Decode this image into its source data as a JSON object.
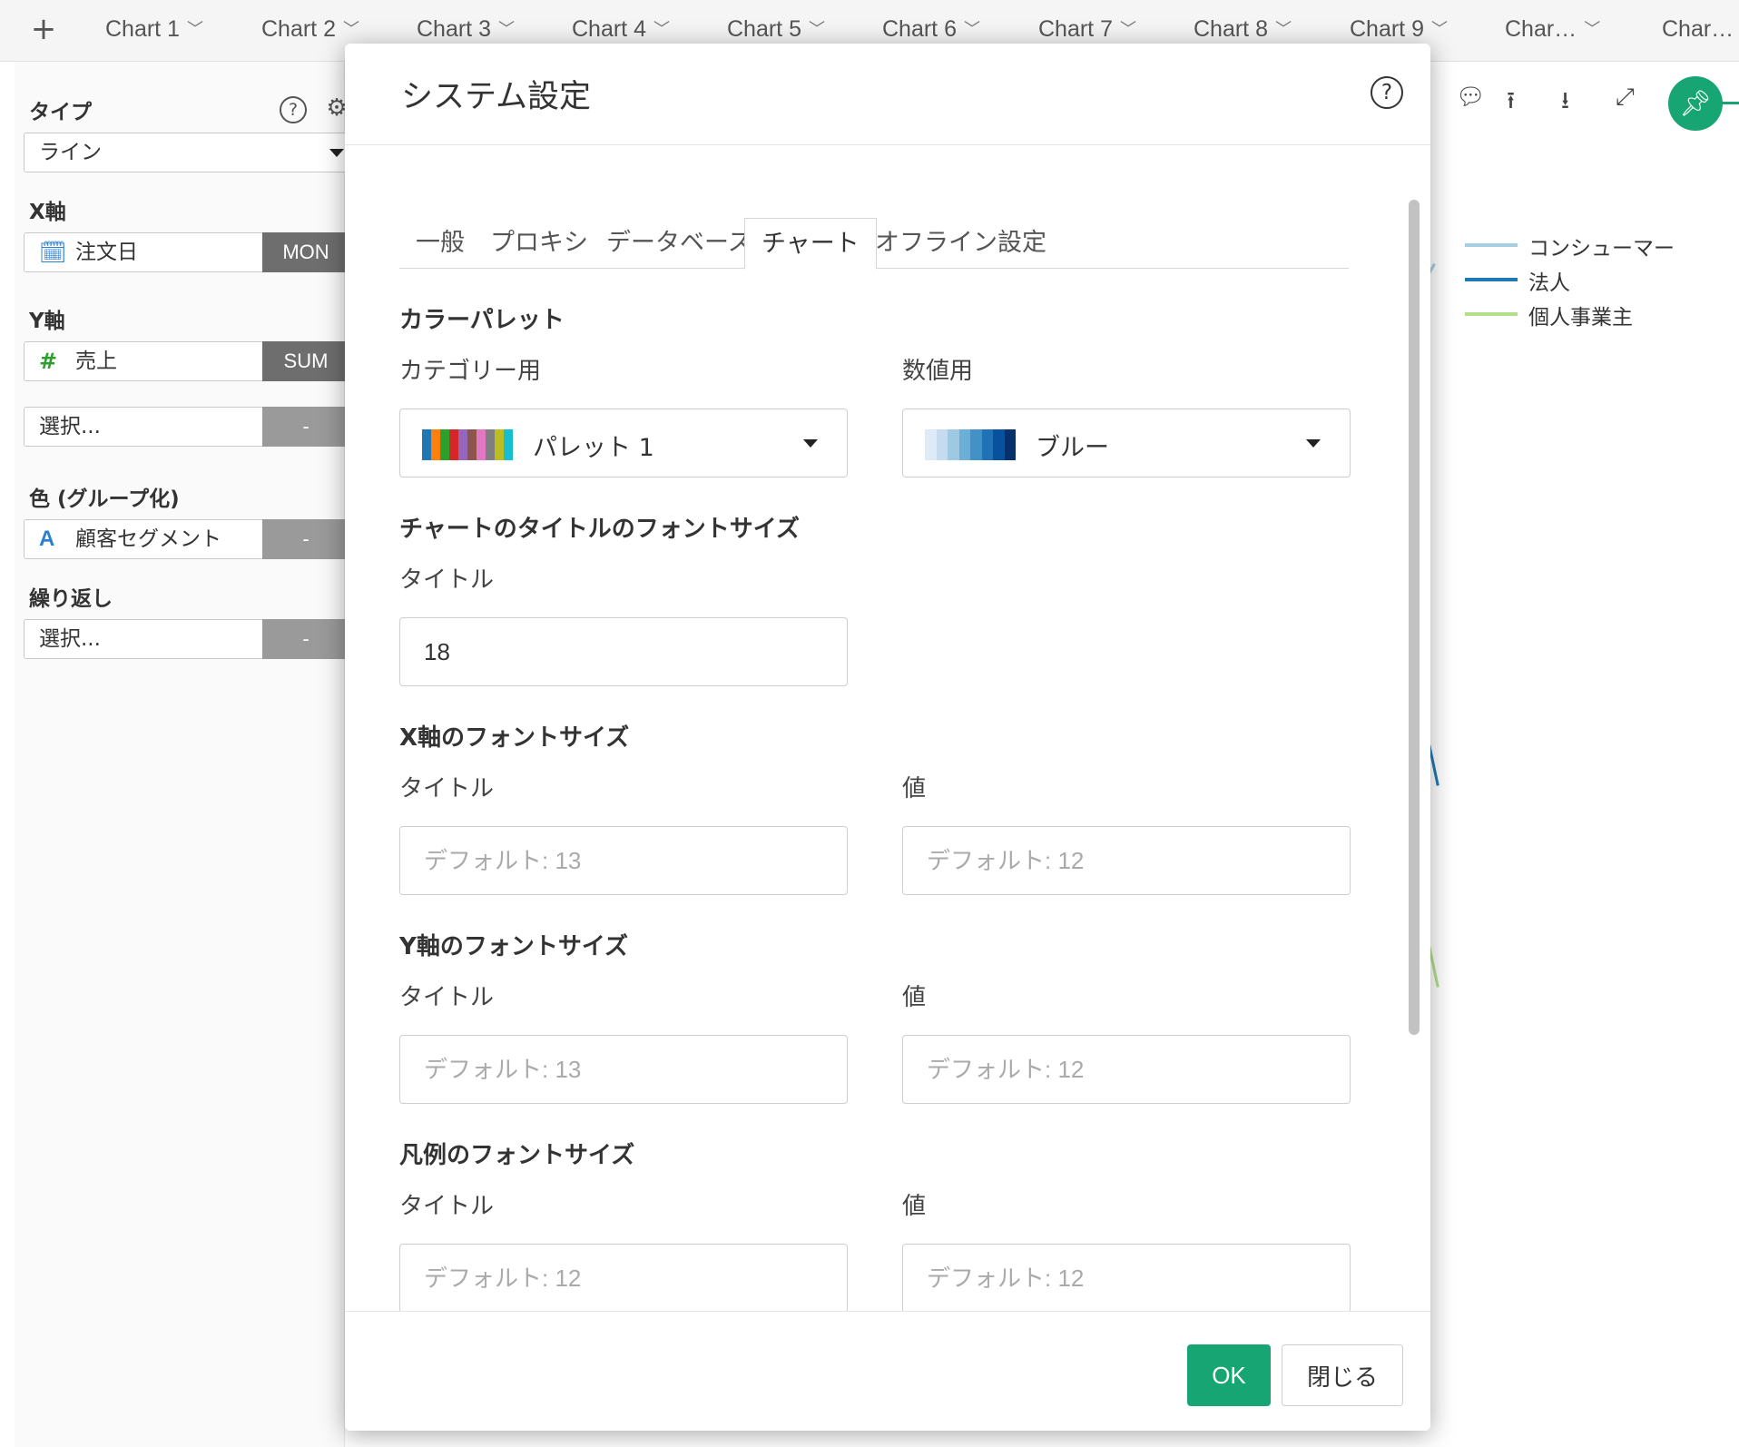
{
  "tabbar": {
    "add_icon": "+",
    "tabs": [
      "Chart 1",
      "Chart 2",
      "Chart 3",
      "Chart 4",
      "Chart 5",
      "Chart 6",
      "Chart 7",
      "Chart 8",
      "Chart 9",
      "Char…",
      "Char…"
    ]
  },
  "left_panel": {
    "type_label": "タイプ",
    "type_value": "ライン",
    "x_label": "X軸",
    "x_field": "注文日",
    "x_agg": "MON",
    "y_label": "Y軸",
    "y_field": "売上",
    "y_agg": "SUM",
    "y_extra_placeholder": "選択...",
    "y_extra_agg": "-",
    "color_label": "色 (グループ化)",
    "color_field": "顧客セグメント",
    "color_agg": "-",
    "repeat_label": "繰り返し",
    "repeat_placeholder": "選択...",
    "repeat_agg": "-"
  },
  "chart_area": {
    "legend": [
      {
        "label": "コンシューマー",
        "color": "#a6cee3"
      },
      {
        "label": "法人",
        "color": "#1f78b4"
      },
      {
        "label": "個人事業主",
        "color": "#b2df8a"
      }
    ]
  },
  "modal": {
    "title": "システム設定",
    "tabs": [
      "一般",
      "プロキシ",
      "データベース",
      "チャート",
      "オフライン設定"
    ],
    "active_tab": "チャート",
    "palette_section": "カラーパレット",
    "category_label": "カテゴリー用",
    "category_value": "パレット 1",
    "numeric_label": "数値用",
    "numeric_value": "ブルー",
    "chart_title_section": "チャートのタイトルのフォントサイズ",
    "chart_title_label": "タイトル",
    "chart_title_value": "18",
    "x_section": "X軸のフォントサイズ",
    "x_title_label": "タイトル",
    "x_title_placeholder": "デフォルト: 13",
    "x_value_label": "値",
    "x_value_placeholder": "デフォルト: 12",
    "y_section": "Y軸のフォントサイズ",
    "y_title_label": "タイトル",
    "y_title_placeholder": "デフォルト: 13",
    "y_value_label": "値",
    "y_value_placeholder": "デフォルト: 12",
    "legend_section": "凡例のフォントサイズ",
    "legend_title_label": "タイトル",
    "legend_title_placeholder": "デフォルト: 12",
    "legend_value_label": "値",
    "legend_value_placeholder": "デフォルト: 12",
    "ok_label": "OK",
    "close_label": "閉じる"
  },
  "colors": {
    "accent_green": "#17a673",
    "palette1": [
      "#1f77b4",
      "#ff7f0e",
      "#2ca02c",
      "#d62728",
      "#9467bd",
      "#8c564b",
      "#e377c2",
      "#7f7f7f",
      "#bcbd22",
      "#17becf"
    ],
    "blue_scale": [
      "#deebf7",
      "#c6dbef",
      "#9ecae1",
      "#6baed6",
      "#4292c6",
      "#2171b5",
      "#08519c",
      "#08306b"
    ]
  }
}
